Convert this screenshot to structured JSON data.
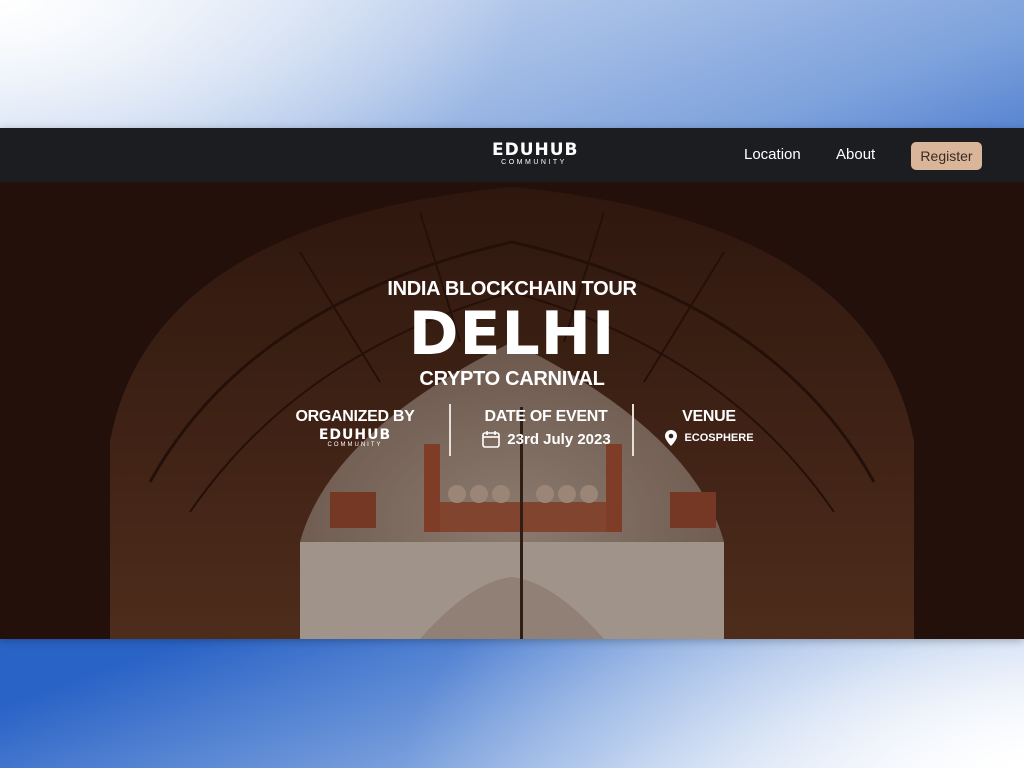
{
  "brand": {
    "logo_main": "EDUHUB",
    "logo_sub": "COMMUNITY"
  },
  "nav": {
    "items": [
      {
        "label": "Location"
      },
      {
        "label": "About"
      }
    ],
    "register_label": "Register"
  },
  "hero": {
    "tour_label": "INDIA BLOCKCHAIN TOUR",
    "city": "DELHI",
    "subtitle": "CRYPTO CARNIVAL",
    "organized_by_title": "ORGANIZED BY",
    "organizer_logo_main": "EDUHUB",
    "organizer_logo_sub": "COMMUNITY",
    "date_title": "DATE OF EVENT",
    "date_value": "23rd July 2023",
    "venue_title": "VENUE",
    "venue_value": "ECOSPHERE"
  },
  "icons": {
    "calendar": "calendar-icon",
    "location": "location-pin-icon"
  },
  "colors": {
    "navbar": "#1c1d21",
    "register_button": "#d9b59a",
    "hero_overlay": "#2b140c"
  }
}
